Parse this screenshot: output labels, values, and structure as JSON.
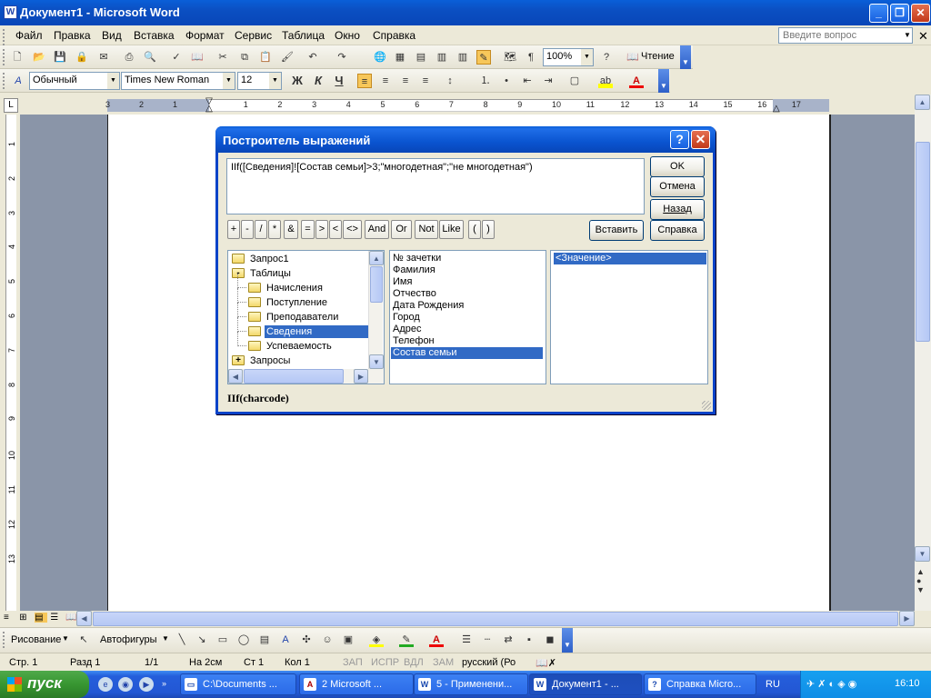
{
  "window": {
    "title": "Документ1 - Microsoft Word"
  },
  "menu": {
    "items": [
      "Файл",
      "Правка",
      "Вид",
      "Вставка",
      "Формат",
      "Сервис",
      "Таблица",
      "Окно",
      "Справка"
    ],
    "help_placeholder": "Введите вопрос"
  },
  "toolbar_standard": {
    "zoom": "100%",
    "reading_label": "Чтение"
  },
  "toolbar_format": {
    "style": "Обычный",
    "font": "Times New Roman",
    "size": "12",
    "bold": "Ж",
    "italic": "К",
    "underline": "Ч"
  },
  "ruler": {
    "numbers": [
      "3",
      "2",
      "1",
      "1",
      "2",
      "3",
      "4",
      "5",
      "6",
      "7",
      "8",
      "9",
      "10",
      "11",
      "12",
      "13",
      "14",
      "15",
      "16",
      "17"
    ]
  },
  "vruler": {
    "numbers": [
      "1",
      "2",
      "3",
      "4",
      "5",
      "6",
      "7",
      "8",
      "9",
      "10",
      "11",
      "12",
      "13"
    ]
  },
  "dialog": {
    "title": "Построитель выражений",
    "expression": "IIf([Сведения]![Состав семьи]>3;\"многодетная\";\"не многодетная\")",
    "buttons": {
      "ok": "OK",
      "cancel": "Отмена",
      "back": "Назад",
      "paste": "Вставить",
      "help": "Справка"
    },
    "operators": [
      "+",
      "-",
      "/",
      "*",
      "&",
      "=",
      ">",
      "<",
      "<>",
      "And",
      "Or",
      "Not",
      "Like",
      "(",
      ")"
    ],
    "tree": [
      {
        "label": "Запрос1",
        "indent": 0,
        "selected": false,
        "expand": ""
      },
      {
        "label": "Таблицы",
        "indent": 0,
        "selected": false,
        "expand": "-"
      },
      {
        "label": "Начисления",
        "indent": 1,
        "selected": false,
        "expand": ""
      },
      {
        "label": "Поступление",
        "indent": 1,
        "selected": false,
        "expand": ""
      },
      {
        "label": "Преподаватели",
        "indent": 1,
        "selected": false,
        "expand": ""
      },
      {
        "label": "Сведения",
        "indent": 1,
        "selected": true,
        "expand": ""
      },
      {
        "label": "Успеваемость",
        "indent": 1,
        "selected": false,
        "expand": ""
      },
      {
        "label": "Запросы",
        "indent": 0,
        "selected": false,
        "expand": "+"
      }
    ],
    "fields": [
      "№ зачетки",
      "Фамилия",
      "Имя",
      "Отчество",
      "Дата Рождения",
      "Город",
      "Адрес",
      "Телефон",
      "Состав семьи"
    ],
    "selected_field": "Состав семьи",
    "values": [
      "<Значение>"
    ],
    "footer": "IIf(charcode)"
  },
  "drawing": {
    "draw_label": "Рисование",
    "autoshapes_label": "Автофигуры"
  },
  "status": {
    "page": "Стр. 1",
    "section": "Разд 1",
    "pages": "1/1",
    "at": "На 2см",
    "line": "Ст 1",
    "col": "Кол 1",
    "rec": "ЗАП",
    "trk": "ИСПР",
    "ext": "ВДЛ",
    "ovr": "ЗАМ",
    "lang": "русский (Ро"
  },
  "taskbar": {
    "start": "пуск",
    "tasks": [
      "C:\\Documents ...",
      "2 Microsoft ...",
      "5 - Применени...",
      "Документ1 - ...",
      "Справка Micro..."
    ],
    "lang": "RU",
    "clock": "16:10"
  },
  "colors": {
    "xp_blue": "#0a5fd8",
    "selection": "#316ac5"
  }
}
